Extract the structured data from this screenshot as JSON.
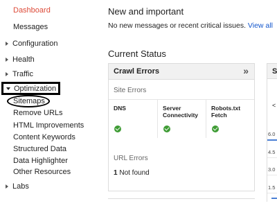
{
  "sidebar": {
    "dashboard": "Dashboard",
    "messages": "Messages",
    "groups": {
      "configuration": "Configuration",
      "health": "Health",
      "traffic": "Traffic",
      "optimization": "Optimization",
      "labs": "Labs"
    },
    "optimization_items": [
      "Sitemaps",
      "Remove URLs",
      "HTML Improvements",
      "Content Keywords",
      "Structured Data",
      "Data Highlighter",
      "Other Resources"
    ]
  },
  "main": {
    "new_heading": "New and important",
    "message_text": "No new messages or recent critical issues.",
    "view_all": "View all",
    "status_heading": "Current Status",
    "crawl_card": {
      "title": "Crawl Errors",
      "expand_glyph": "»",
      "site_errors_label": "Site Errors",
      "columns": [
        {
          "label_1": "DNS",
          "label_2": ""
        },
        {
          "label_1": "Server",
          "label_2": "Connectivity"
        },
        {
          "label_1": "Robots.txt",
          "label_2": "Fetch"
        }
      ],
      "url_errors_label": "URL Errors",
      "not_found_count": "1",
      "not_found_label": "Not found"
    },
    "second_card": {
      "title_fragment": "S",
      "nav_glyph": "<",
      "ticks": [
        "6.0",
        "4.5",
        "3.0",
        "1.5"
      ]
    }
  },
  "colors": {
    "dashboard_active": "#dd4b39",
    "link": "#1155cc",
    "check_ok": "#3f9c35",
    "chart_line": "#4a7fd4"
  }
}
